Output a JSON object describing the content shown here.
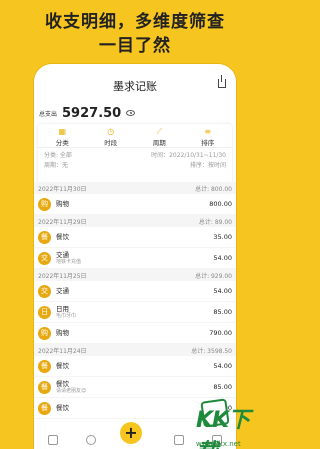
{
  "promo": {
    "line1": "收支明细，多维度筛查",
    "line2": "一目了然"
  },
  "app": {
    "title": "墨求记账"
  },
  "summary": {
    "label": "总支出",
    "value": "5927.50"
  },
  "filter": {
    "tabs": [
      {
        "label": "分类",
        "icon": "grid-icon"
      },
      {
        "label": "时段",
        "icon": "clock-icon"
      },
      {
        "label": "周期",
        "icon": "trend-icon"
      },
      {
        "label": "排序",
        "icon": "sort-icon"
      }
    ],
    "category": "分类: 全部",
    "time_range": "时间：2022/10/31~11/30",
    "period": "周期：无",
    "sort": "排序：按时间"
  },
  "groups": [
    {
      "date": "2022年11月30日",
      "total": "总计: 800.00",
      "items": [
        {
          "icon": "购",
          "name": "购物",
          "note": "",
          "amount": "800.00"
        }
      ]
    },
    {
      "date": "2022年11月29日",
      "total": "总计: 89.00",
      "items": [
        {
          "icon": "餐",
          "name": "餐饮",
          "note": "",
          "amount": "35.00"
        },
        {
          "icon": "交",
          "name": "交通",
          "note": "地铁卡充值",
          "amount": "54.00"
        }
      ]
    },
    {
      "date": "2022年11月25日",
      "total": "总计: 929.00",
      "items": [
        {
          "icon": "交",
          "name": "交通",
          "note": "",
          "amount": "54.00"
        },
        {
          "icon": "日",
          "name": "日用",
          "note": "毛巾牙巾",
          "amount": "85.00"
        },
        {
          "icon": "购",
          "name": "购物",
          "note": "",
          "amount": "790.00"
        }
      ]
    },
    {
      "date": "2022年11月24日",
      "total": "总计: 3598.50",
      "items": [
        {
          "icon": "餐",
          "name": "餐饮",
          "note": "",
          "amount": "54.00"
        },
        {
          "icon": "餐",
          "name": "餐饮",
          "note": "请请老朋友😊",
          "amount": "85.00"
        },
        {
          "icon": "餐",
          "name": "餐饮",
          "note": "",
          "amount": "829.00"
        }
      ]
    }
  ],
  "tabbar": {
    "add": "+"
  },
  "watermark": {
    "text": "KK下载",
    "url": "www.kkx.net"
  },
  "colors": {
    "accent": "#f7c51f",
    "icon_bg": "#e8a80f"
  }
}
